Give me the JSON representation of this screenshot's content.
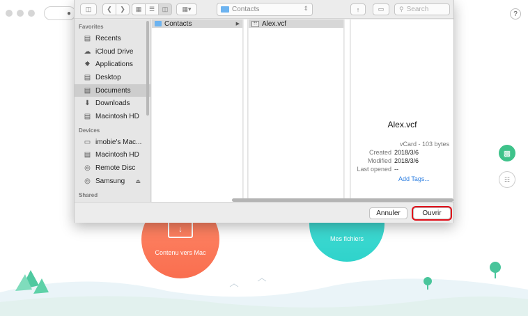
{
  "app": {
    "help_label": "?",
    "circles": [
      {
        "label": "Contenu vers Mac",
        "color": "#f97a5a"
      },
      {
        "label": "Mes fichiers",
        "color": "#36d6cf"
      }
    ]
  },
  "toolbar": {
    "path": "Contacts",
    "search_placeholder": "Search"
  },
  "sidebar": {
    "sections": [
      {
        "title": "Favorites",
        "items": [
          {
            "label": "Recents",
            "icon": "recents-icon"
          },
          {
            "label": "iCloud Drive",
            "icon": "cloud-icon"
          },
          {
            "label": "Applications",
            "icon": "applications-icon"
          },
          {
            "label": "Desktop",
            "icon": "desktop-icon"
          },
          {
            "label": "Documents",
            "icon": "documents-icon",
            "selected": true
          },
          {
            "label": "Downloads",
            "icon": "downloads-icon"
          },
          {
            "label": "Macintosh HD",
            "icon": "disk-icon"
          }
        ]
      },
      {
        "title": "Devices",
        "items": [
          {
            "label": "imobie's Mac...",
            "icon": "laptop-icon"
          },
          {
            "label": "Macintosh HD",
            "icon": "disk-icon"
          },
          {
            "label": "Remote Disc",
            "icon": "disc-icon"
          },
          {
            "label": "Samsung",
            "icon": "disc-icon",
            "eject": true
          }
        ]
      },
      {
        "title": "Shared",
        "items": []
      }
    ]
  },
  "browser": {
    "column1": [
      {
        "label": "Contacts",
        "type": "folder",
        "selected": true
      }
    ],
    "column2": [
      {
        "label": "Alex.vcf",
        "type": "vcard",
        "selected": true
      }
    ]
  },
  "preview": {
    "name": "Alex.vcf",
    "kind": "vCard - 103 bytes",
    "created_label": "Created",
    "created": "2018/3/6",
    "modified_label": "Modified",
    "modified": "2018/3/6",
    "last_opened_label": "Last opened",
    "last_opened": "--",
    "add_tags": "Add Tags..."
  },
  "buttons": {
    "cancel": "Annuler",
    "open": "Ouvrir",
    "highlight_color": "#e0101a"
  }
}
